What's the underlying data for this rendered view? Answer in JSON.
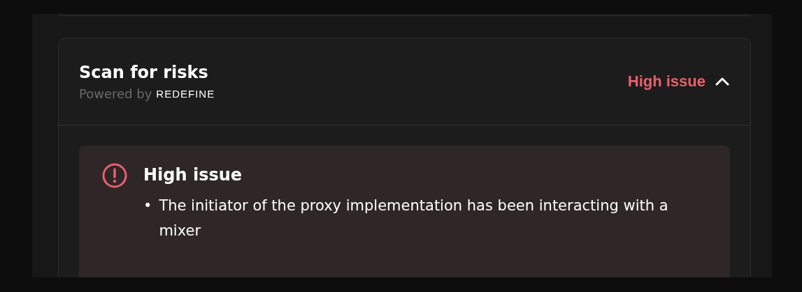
{
  "scan": {
    "title": "Scan for risks",
    "powered_by": "Powered by",
    "logo": "REDEFINE",
    "severity": "High issue",
    "expanded": true
  },
  "issue": {
    "title": "High issue",
    "items": [
      {
        "bullet": "•",
        "text": "The initiator of the proxy implementation has been interacting with a mixer"
      }
    ]
  }
}
